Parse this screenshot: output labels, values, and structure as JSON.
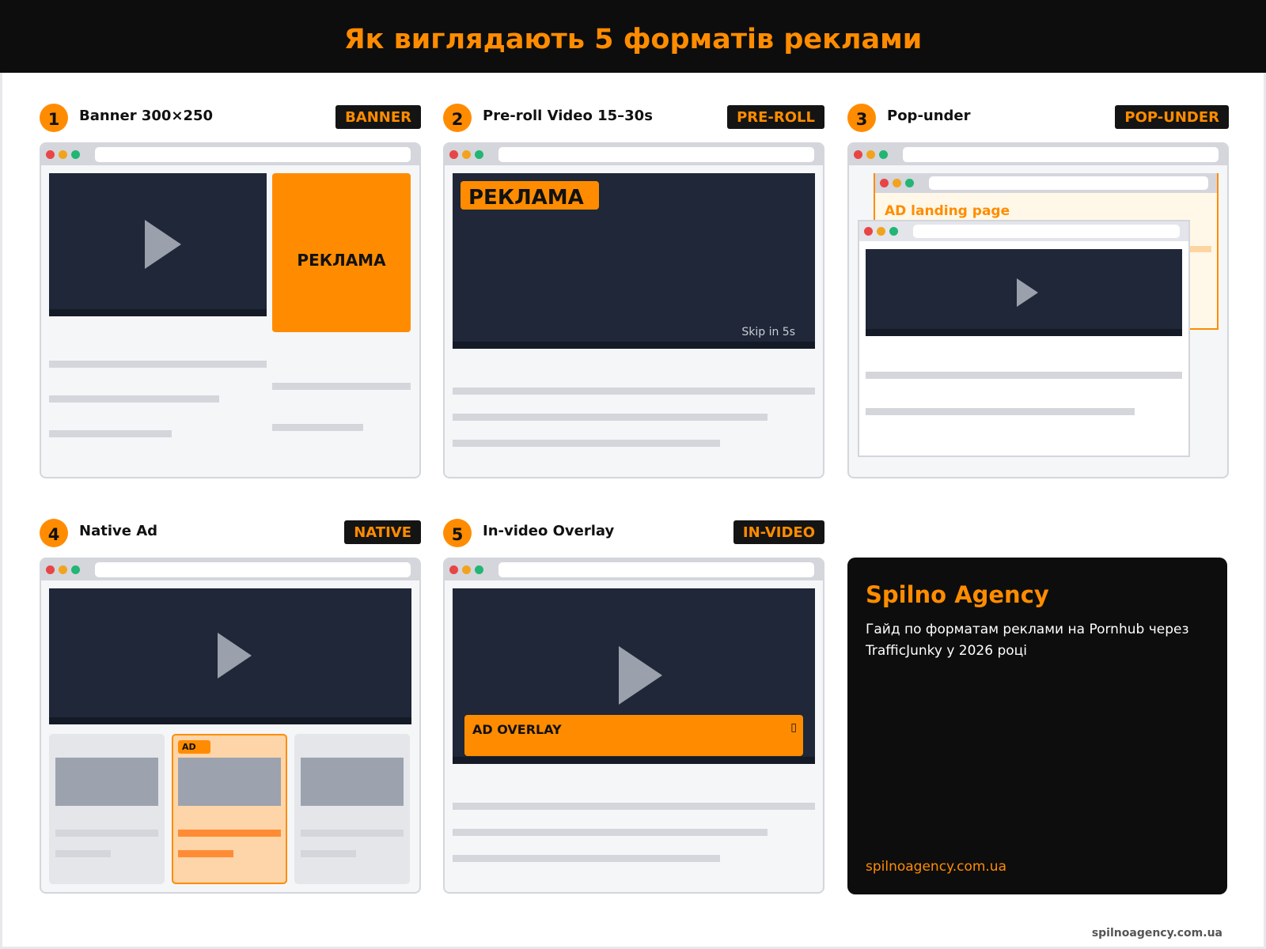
{
  "header": {
    "title": "Як виглядають 5 форматів реклами"
  },
  "panels": [
    {
      "number": "1",
      "title": "Banner 300×250",
      "tag": "BANNER",
      "ad_label": "РЕКЛАМА"
    },
    {
      "number": "2",
      "title": "Pre-roll Video 15–30s",
      "tag": "PRE-ROLL",
      "ad_label": "РЕКЛАМА",
      "skip_text": "Skip in 5s"
    },
    {
      "number": "3",
      "title": "Pop-under",
      "tag": "POP-UNDER",
      "landing_label": "AD landing page"
    },
    {
      "number": "4",
      "title": "Native Ad",
      "tag": "NATIVE",
      "ad_badge": "AD"
    },
    {
      "number": "5",
      "title": "In-video Overlay",
      "tag": "IN-VIDEO",
      "overlay_label": "AD OVERLAY",
      "close_glyph": "▯"
    }
  ],
  "info_card": {
    "title": "Spilno Agency",
    "description": "Гайд по форматам реклами на Pornhub через TrafficJunky у 2026 році",
    "url": "spilnoagency.com.ua"
  },
  "footer": {
    "url": "spilnoagency.com.ua"
  },
  "colors": {
    "accent": "#ff8c00",
    "dark": "#0d0d0d",
    "video": "#1f2738",
    "placeholder": "#d4d6dc"
  }
}
